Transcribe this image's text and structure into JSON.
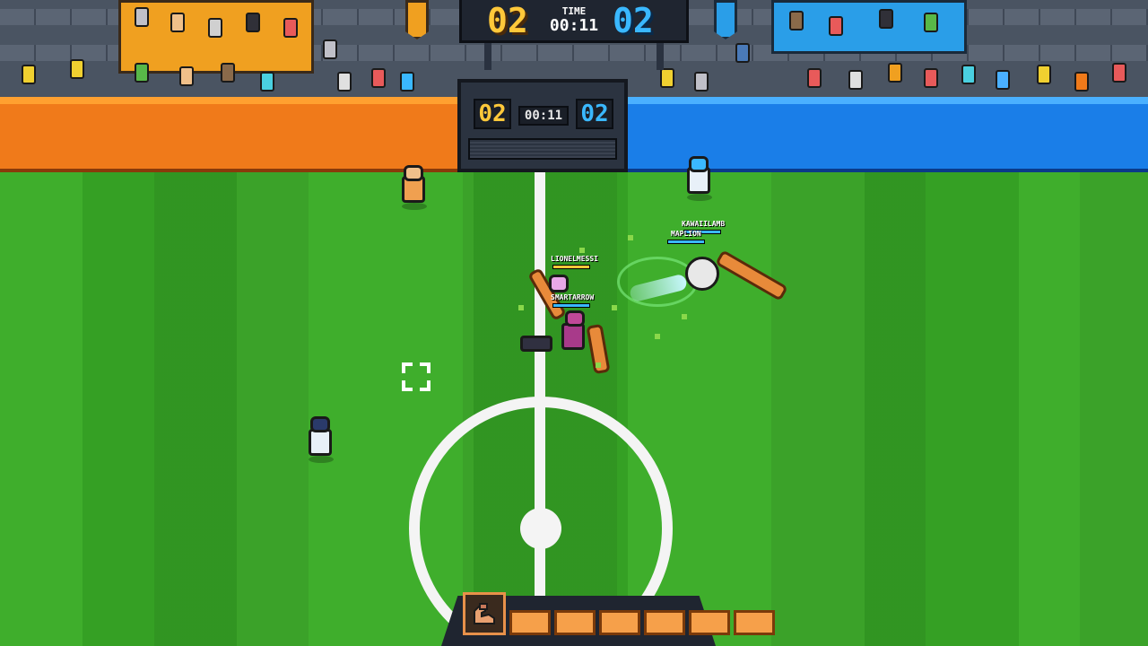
{
  "hud": {
    "score_orange": "02",
    "score_blue": "02",
    "time_label": "TIME",
    "time_value": "00:11"
  },
  "field_board": {
    "score_orange": "02",
    "score_blue": "02",
    "time_value": "00:11"
  },
  "players": {
    "lionelmessi": "LIONELMESSI",
    "smartarrow": "SMARTARROW",
    "kawaiilamb": "KAWAIILAMB",
    "maplion": "MAPLION"
  },
  "power": {
    "icon": "flexed-arm-icon",
    "filled_segments": 6,
    "total_segments": 6
  },
  "colors": {
    "team_orange": "#f07a1a",
    "team_blue": "#1a7ee8",
    "score_orange": "#ffc83a",
    "score_blue": "#3ab8ff",
    "grass_light": "#3fae2c",
    "grass_dark": "#35a024",
    "power_fill": "#f6a04a"
  }
}
